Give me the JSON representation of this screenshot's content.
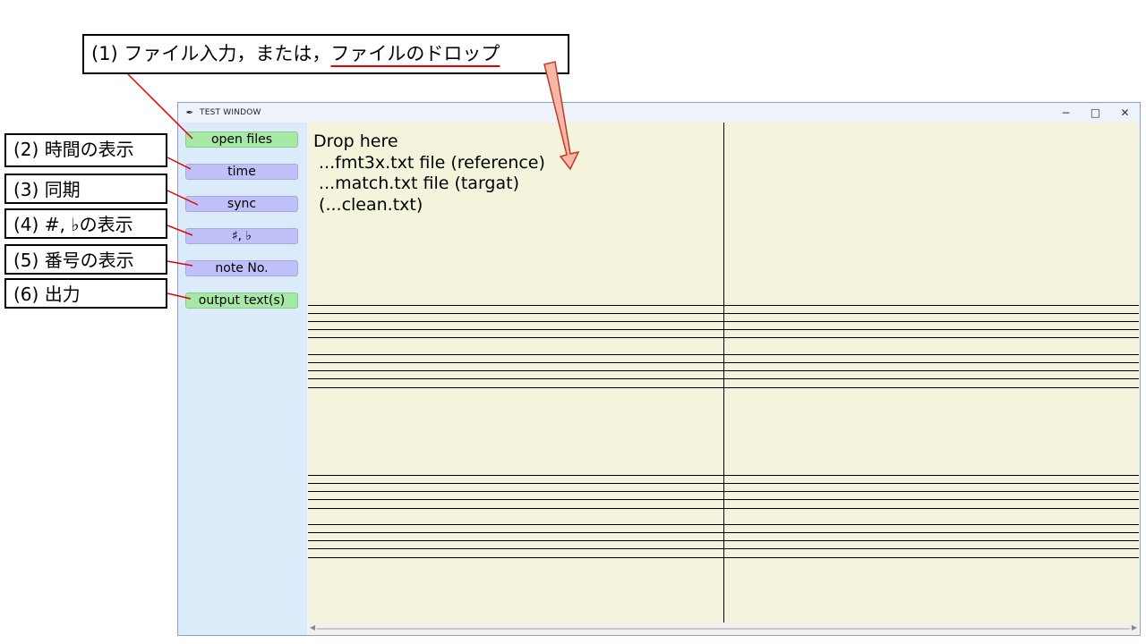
{
  "callouts": {
    "c1_prefix": "(1) ファイル入力，または，",
    "c1_underlined": "ファイルのドロップ",
    "c2": "(2) 時間の表示",
    "c3": "(3) 同期",
    "c4": "(4) #, ♭の表示",
    "c5": "(5) 番号の表示",
    "c6": "(6) 出力"
  },
  "window": {
    "title": "TEST WINDOW",
    "app_icon": "feather-icon",
    "controls": {
      "minimize": "−",
      "maximize": "□",
      "close": "✕"
    }
  },
  "sidebar": {
    "buttons": [
      {
        "label": "open files",
        "color": "#a6e8a6"
      },
      {
        "label": "time",
        "color": "#c0c0f8"
      },
      {
        "label": "sync",
        "color": "#c0c0f8"
      },
      {
        "label": "♯, ♭",
        "color": "#c0c0f8"
      },
      {
        "label": "note No.",
        "color": "#c0c0f8"
      },
      {
        "label": "output text(s)",
        "color": "#a6e8a6"
      }
    ]
  },
  "content": {
    "drop_lines": [
      "Drop here",
      " ...fmt3x.txt file (reference)",
      " ...match.txt file (targat)",
      " (...clean.txt)"
    ],
    "background": "#f4f4dd"
  },
  "colors": {
    "annotation_red": "#e60000",
    "arrow_fill": "#f6b7a4"
  }
}
